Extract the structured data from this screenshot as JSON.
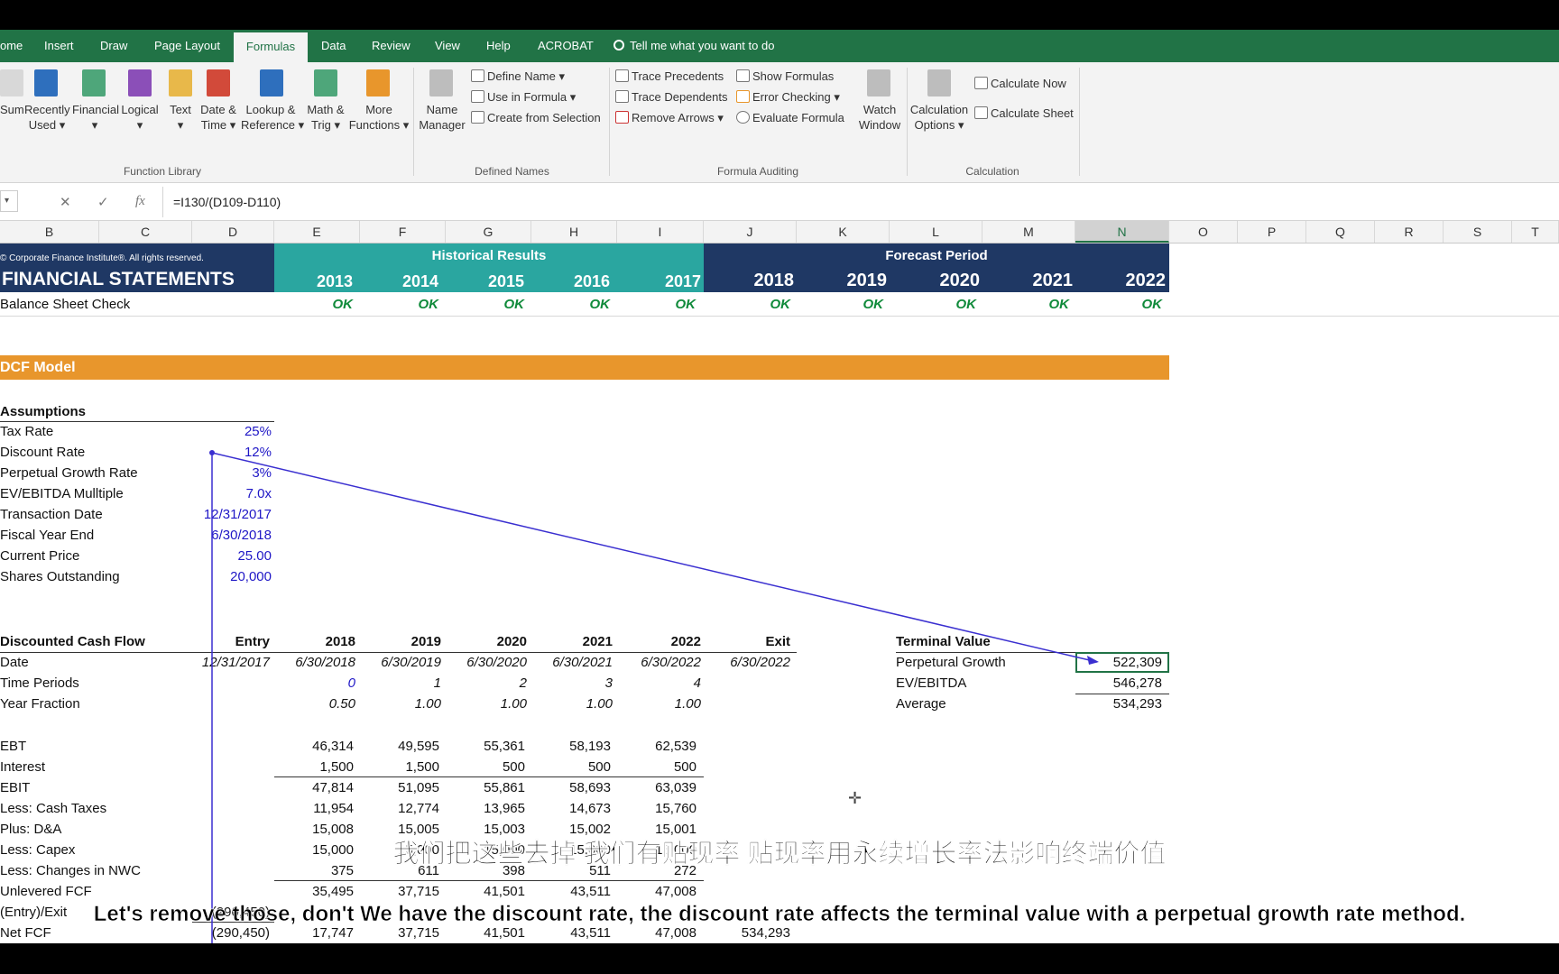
{
  "ribbon_tabs": {
    "home": "ome",
    "insert": "Insert",
    "draw": "Draw",
    "page_layout": "Page Layout",
    "formulas": "Formulas",
    "data": "Data",
    "review": "Review",
    "view": "View",
    "help": "Help",
    "acrobat": "ACROBAT"
  },
  "tell_me": "Tell me what you want to do",
  "function_library": {
    "autosum": "Sum",
    "recently_used_1": "Recently",
    "recently_used_2": "Used",
    "financial": "Financial",
    "logical": "Logical",
    "text": "Text",
    "datetime_1": "Date &",
    "datetime_2": "Time",
    "lookup_1": "Lookup &",
    "lookup_2": "Reference",
    "math_1": "Math &",
    "math_2": "Trig",
    "more_1": "More",
    "more_2": "Functions",
    "group": "Function Library"
  },
  "defined_names": {
    "name_manager_1": "Name",
    "name_manager_2": "Manager",
    "define_name": "Define Name",
    "use_in_formula": "Use in Formula",
    "create_from_selection": "Create from Selection",
    "group": "Defined Names"
  },
  "formula_auditing": {
    "trace_precedents": "Trace Precedents",
    "trace_dependents": "Trace Dependents",
    "remove_arrows": "Remove Arrows",
    "show_formulas": "Show Formulas",
    "error_checking": "Error Checking",
    "evaluate_formula": "Evaluate Formula",
    "watch_1": "Watch",
    "watch_2": "Window",
    "group": "Formula Auditing"
  },
  "calculation": {
    "options_1": "Calculation",
    "options_2": "Options",
    "calc_now": "Calculate Now",
    "calc_sheet": "Calculate Sheet",
    "group": "Calculation"
  },
  "formula_bar": {
    "formula": "=I130/(D109-D110)",
    "fx": "fx",
    "cancel": "✕",
    "enter": "✓"
  },
  "columns": [
    "B",
    "C",
    "D",
    "E",
    "F",
    "G",
    "H",
    "I",
    "J",
    "K",
    "L",
    "M",
    "N",
    "O",
    "P",
    "Q",
    "R",
    "S",
    "T"
  ],
  "header": {
    "copyright": "© Corporate Finance Institute®. All rights reserved.",
    "title": "FINANCIAL STATEMENTS",
    "historical": "Historical Results",
    "forecast": "Forecast Period",
    "years": [
      "2013",
      "2014",
      "2015",
      "2016",
      "2017",
      "2018",
      "2019",
      "2020",
      "2021",
      "2022"
    ],
    "check_label": "Balance Sheet Check",
    "check_values": [
      "OK",
      "OK",
      "OK",
      "OK",
      "OK",
      "OK",
      "OK",
      "OK",
      "OK",
      "OK"
    ]
  },
  "dcf_title": "DCF Model",
  "assumptions": {
    "heading": "Assumptions",
    "rows": [
      {
        "label": "Tax Rate",
        "value": "25%"
      },
      {
        "label": "Discount Rate",
        "value": "12%"
      },
      {
        "label": "Perpetual Growth Rate",
        "value": "3%"
      },
      {
        "label": "EV/EBITDA Mulltiple",
        "value": "7.0x"
      },
      {
        "label": "Transaction Date",
        "value": "12/31/2017"
      },
      {
        "label": "Fiscal Year End",
        "value": "6/30/2018"
      },
      {
        "label": "Current Price",
        "value": "25.00"
      },
      {
        "label": "Shares Outstanding",
        "value": "20,000"
      }
    ]
  },
  "dcf": {
    "heading": "Discounted Cash Flow",
    "col_headers": [
      "Entry",
      "2018",
      "2019",
      "2020",
      "2021",
      "2022",
      "Exit"
    ],
    "date_label": "Date",
    "dates": [
      "12/31/2017",
      "6/30/2018",
      "6/30/2019",
      "6/30/2020",
      "6/30/2021",
      "6/30/2022",
      "6/30/2022"
    ],
    "periods_label": "Time Periods",
    "periods": [
      "0",
      "1",
      "2",
      "3",
      "4"
    ],
    "fraction_label": "Year Fraction",
    "fractions": [
      "0.50",
      "1.00",
      "1.00",
      "1.00",
      "1.00"
    ],
    "rows": [
      {
        "label": "EBT",
        "values": [
          "46,314",
          "49,595",
          "55,361",
          "58,193",
          "62,539"
        ]
      },
      {
        "label": "Interest",
        "values": [
          "1,500",
          "1,500",
          "500",
          "500",
          "500"
        ]
      },
      {
        "label": "EBIT",
        "values": [
          "47,814",
          "51,095",
          "55,861",
          "58,693",
          "63,039"
        ]
      },
      {
        "label": "Less: Cash Taxes",
        "values": [
          "11,954",
          "12,774",
          "13,965",
          "14,673",
          "15,760"
        ]
      },
      {
        "label": "Plus: D&A",
        "values": [
          "15,008",
          "15,005",
          "15,003",
          "15,002",
          "15,001"
        ]
      },
      {
        "label": "Less: Capex",
        "values": [
          "15,000",
          "15,000",
          "15,000",
          "15,000",
          "15,000"
        ]
      },
      {
        "label": "Less: Changes in NWC",
        "values": [
          "375",
          "611",
          "398",
          "511",
          "272"
        ]
      },
      {
        "label": "Unlevered FCF",
        "values": [
          "35,495",
          "37,715",
          "41,501",
          "43,511",
          "47,008"
        ]
      }
    ],
    "entry_exit_label": "(Entry)/Exit",
    "entry_value": "(290,450)",
    "net_fcf_label": "Net FCF",
    "net_fcf_entry": "(290,450)",
    "net_fcf_values": [
      "17,747",
      "37,715",
      "41,501",
      "43,511",
      "47,008"
    ],
    "net_fcf_exit": "534,293"
  },
  "terminal_value": {
    "heading": "Terminal Value",
    "rows": [
      {
        "label": "Perpetural Growth",
        "value": "522,309"
      },
      {
        "label": "EV/EBITDA",
        "value": "546,278"
      },
      {
        "label": "Average",
        "value": "534,293"
      }
    ]
  },
  "subtitles": {
    "chinese": "我们把这些去掉 我们有贴现率 贴现率用永续增长率法影响终端价值",
    "english": "Let's remove those, don't We have the discount rate, the discount rate affects the terminal value with a perpetual growth rate method."
  }
}
